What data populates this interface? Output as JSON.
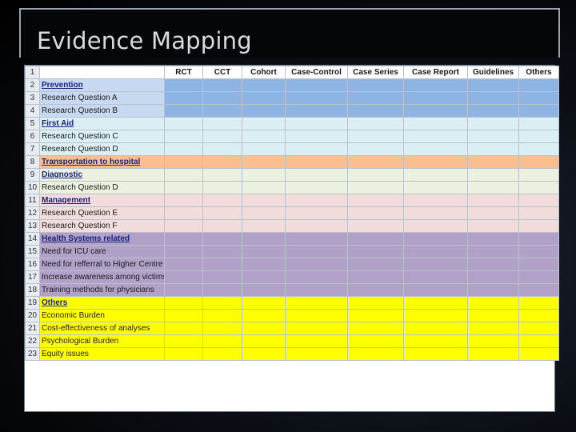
{
  "title": "Evidence Mapping",
  "columns": [
    "RCT",
    "CCT",
    "Cohort",
    "Case-Control",
    "Case Series",
    "Case Report",
    "Guidelines",
    "Others"
  ],
  "rows": [
    {
      "num": "2",
      "label": "Prevention",
      "head": true,
      "group": "g-prev"
    },
    {
      "num": "3",
      "label": "Research Question A",
      "group": "g-prev"
    },
    {
      "num": "4",
      "label": "Research Question B",
      "group": "g-prev"
    },
    {
      "num": "5",
      "label": "First Aid",
      "head": true,
      "group": "g-first"
    },
    {
      "num": "6",
      "label": "Research Question C",
      "group": "g-first"
    },
    {
      "num": "7",
      "label": "Research Question D",
      "group": "g-first"
    },
    {
      "num": "8",
      "label": "Transportation to hospital",
      "head": true,
      "group": "g-trans",
      "tall": true
    },
    {
      "num": "9",
      "label": "Diagnostic",
      "head": true,
      "group": "g-diag"
    },
    {
      "num": "10",
      "label": "Research Question D",
      "group": "g-diag"
    },
    {
      "num": "11",
      "label": "Management",
      "head": true,
      "group": "g-mgmt"
    },
    {
      "num": "12",
      "label": "Research Question E",
      "group": "g-mgmt"
    },
    {
      "num": "13",
      "label": "Research Question F",
      "group": "g-mgmt"
    },
    {
      "num": "14",
      "label": "Health Systems related",
      "head": true,
      "group": "g-health"
    },
    {
      "num": "15",
      "label": "Need for ICU care",
      "group": "g-health"
    },
    {
      "num": "16",
      "label": "Need for refferral to Higher Centre",
      "group": "g-health",
      "tall": true
    },
    {
      "num": "17",
      "label": "Increase awareness among victims",
      "group": "g-health",
      "tall": true
    },
    {
      "num": "18",
      "label": "Training methods for physicians",
      "group": "g-health"
    },
    {
      "num": "19",
      "label": "Others",
      "head": true,
      "group": "g-other"
    },
    {
      "num": "20",
      "label": "Economic Burden",
      "group": "g-other"
    },
    {
      "num": "21",
      "label": "Cost-effectiveness of analyses",
      "group": "g-other",
      "tall": true
    },
    {
      "num": "22",
      "label": "Psychological Burden",
      "group": "g-other"
    },
    {
      "num": "23",
      "label": "Equity issues",
      "group": "g-other"
    }
  ],
  "header_row_num": "1"
}
